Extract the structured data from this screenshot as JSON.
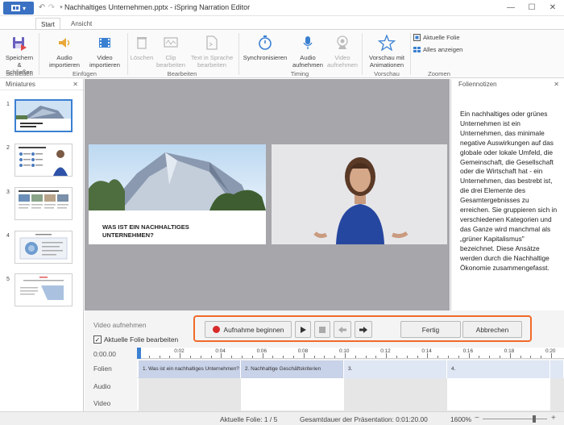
{
  "titlebar": {
    "app_menu_label": "▾",
    "title": "Nachhaltiges Unternehmen.pptx - iSpring Narration Editor"
  },
  "tabs": [
    {
      "label": "Start",
      "active": true
    },
    {
      "label": "Ansicht",
      "active": false
    }
  ],
  "ribbon": {
    "save": "Speichern\n& Schließen",
    "audio_import": "Audio\nimportieren",
    "video_import": "Video\nimportieren",
    "delete": "Löschen",
    "clip_edit": "Clip\nbearbeiten",
    "tts_edit": "Text in Sprache\nbearbeiten",
    "sync": "Synchronisieren",
    "audio_rec": "Audio\naufnehmen",
    "video_rec": "Video\naufnehmen",
    "preview": "Vorschau mit\nAnimationen",
    "current_slide": "Aktuelle Folie",
    "show_all": "Alles anzeigen",
    "groups": {
      "close": "Schließen",
      "insert": "Einfügen",
      "edit": "Bearbeiten",
      "timing": "Timing",
      "preview": "Vorschau",
      "zoom": "Zoomen"
    }
  },
  "miniatures": {
    "title": "Miniatures",
    "items": [
      {
        "num": "1",
        "caption": "WAS IST EIN NACHHALTIGES UNTERNEHMEN?"
      },
      {
        "num": "2",
        "caption": "NACHHALTIGE GESCHÄFTSKRITERIEN"
      },
      {
        "num": "3",
        "caption": ""
      },
      {
        "num": "4",
        "caption": ""
      },
      {
        "num": "5",
        "caption": ""
      }
    ]
  },
  "slide": {
    "heading_line1": "WAS IST EIN NACHHALTIGES",
    "heading_line2": "UNTERNEHMEN?"
  },
  "notes": {
    "title": "Foliennotizen",
    "text": "Ein nachhaltiges oder grünes Unternehmen ist ein Unternehmen, das minimale negative Auswirkungen auf das globale oder lokale Umfeld, die Gemeinschaft, die Gesellschaft oder die Wirtschaft hat - ein Unternehmen, das bestrebt ist, die drei Elemente des Gesamtergebnisses zu erreichen. Sie gruppieren sich in verschiedenen Kategorien und das Ganze wird manchmal als „grüner Kapitalismus\" bezeichnet. Diese Ansätze werden durch die Nachhaltige Ökonomie zusammengefasst."
  },
  "recording": {
    "label": "Video aufnehmen",
    "checkbox_label": "Aktuelle Folie bearbeiten",
    "checkbox_checked": true,
    "start_button": "Aufnahme beginnen",
    "done_button": "Fertig",
    "cancel_button": "Abbrechen"
  },
  "timeline": {
    "time_start": "0:00.00",
    "ticks": [
      "0:02",
      "0:04",
      "0:06",
      "0:08",
      "0:10",
      "0:12",
      "0:14",
      "0:16",
      "0:18",
      "0:20"
    ],
    "rows": [
      "Folien",
      "Audio",
      "Video"
    ],
    "segments": [
      {
        "label": "1. Was ist ein nachhaltiges Unternehmen?"
      },
      {
        "label": "2. Nachhaltige Geschäftskriterien"
      },
      {
        "label": "3."
      },
      {
        "label": "4."
      },
      {
        "label": ""
      }
    ]
  },
  "status": {
    "current_slide": "Aktuelle Folie: 1 / 5",
    "total_duration": "Gesamtdauer der Präsentation: 0:01:20.00",
    "zoom": "1600%"
  },
  "colors": {
    "accent": "#3a71c2",
    "record_frame": "#f06a2a",
    "record_dot": "#d72b2b",
    "stage": "#a6a6ab"
  }
}
